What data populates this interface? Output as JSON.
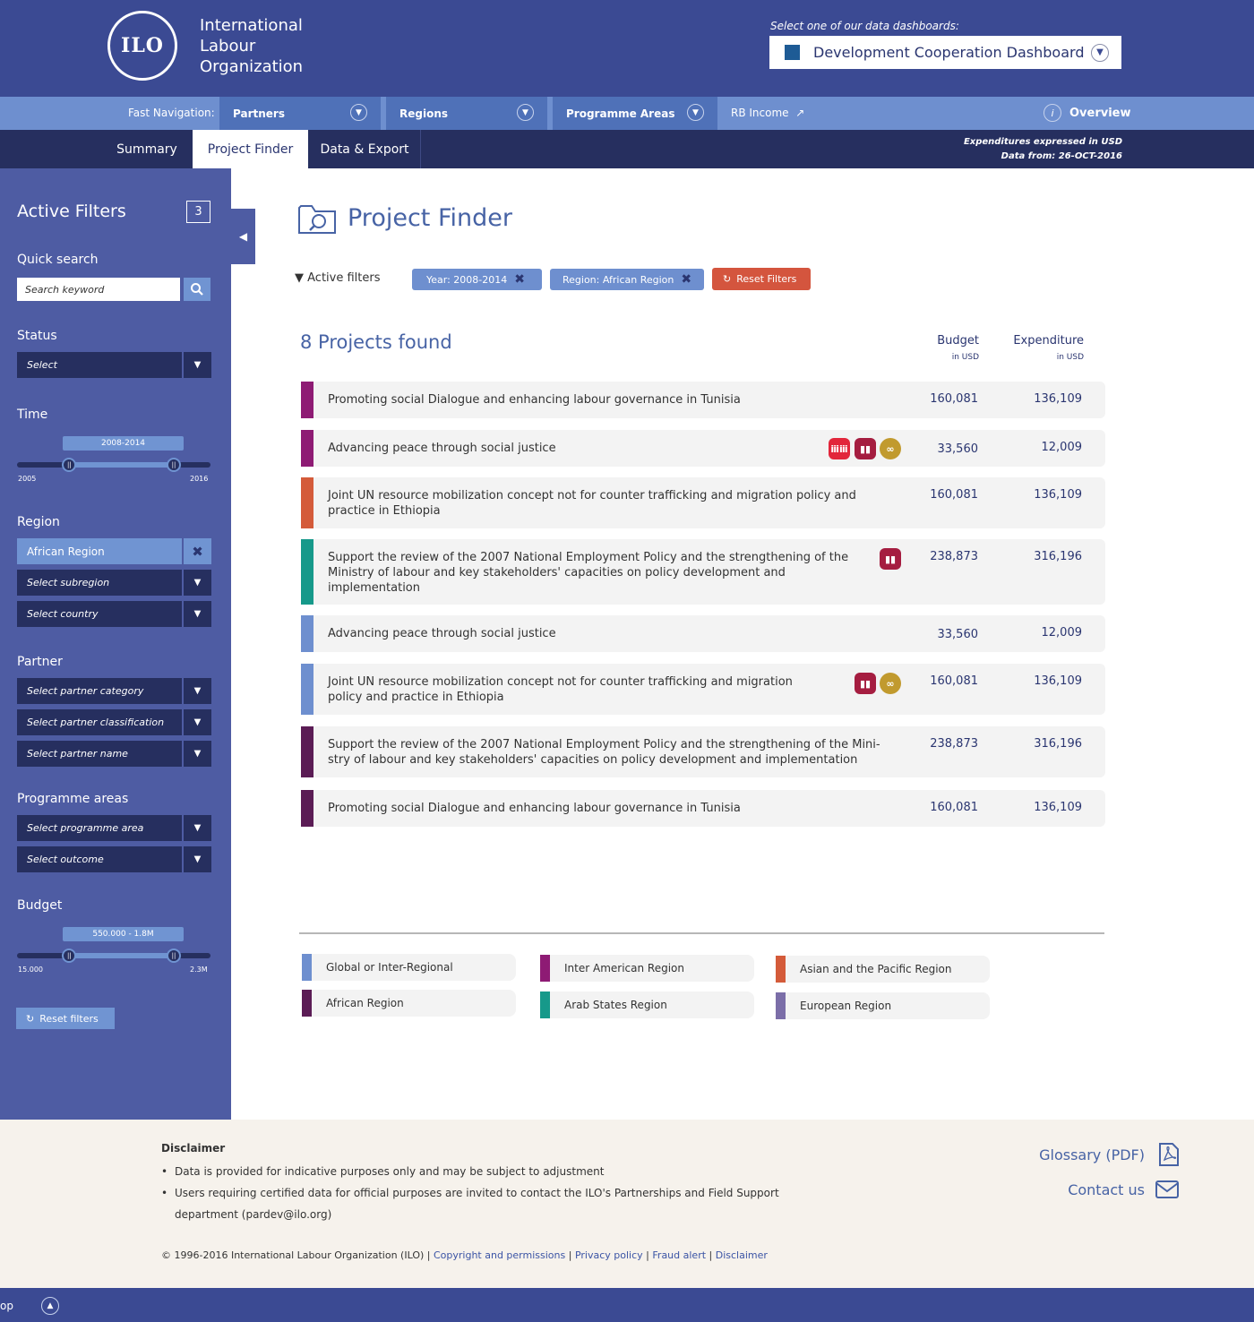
{
  "header": {
    "logo_text": "ILO",
    "org_line1": "International",
    "org_line2": "Labour",
    "org_line3": "Organization",
    "dashboard_prompt": "Select one of our data dashboards:",
    "dashboard_selected": "Development Cooperation Dashboard"
  },
  "fastnav": {
    "label": "Fast Navigation:",
    "partners": "Partners",
    "regions": "Regions",
    "programme_areas": "Programme Areas",
    "rb_income": "RB Income",
    "overview": "Overview"
  },
  "tabs": {
    "summary": "Summary",
    "project_finder": "Project Finder",
    "data_export": "Data & Export",
    "note_line1": "Expenditures expressed in USD",
    "note_line2": "Data from: 26-OCT-2016"
  },
  "sidebar": {
    "title": "Active Filters",
    "count": "3",
    "quick_search_label": "Quick search",
    "search_placeholder": "Search keyword",
    "status_label": "Status",
    "status_select": "Select",
    "time_label": "Time",
    "time_range": "2008-2014",
    "time_min": "2005",
    "time_max": "2016",
    "time_low_fraction": 0.27,
    "time_high_fraction": 0.81,
    "region_label": "Region",
    "region_selected": "African Region",
    "subregion_select": "Select subregion",
    "country_select": "Select country",
    "partner_label": "Partner",
    "partner_category": "Select partner category",
    "partner_classification": "Select partner classification",
    "partner_name": "Select partner name",
    "programme_label": "Programme areas",
    "programme_area": "Select programme area",
    "outcome": "Select outcome",
    "budget_label": "Budget",
    "budget_range": "550.000 - 1.8M",
    "budget_min": "15.000",
    "budget_max": "2.3M",
    "budget_low_fraction": 0.27,
    "budget_high_fraction": 0.81,
    "reset": "Reset filters"
  },
  "main": {
    "title": "Project Finder",
    "active_filters_label": "Active filters",
    "chip_year": "Year: 2008-2014",
    "chip_region": "Region: African Region",
    "reset_filters": "Reset Filters",
    "found": "8 Projects found",
    "budget_header": "Budget",
    "budget_unit": "in USD",
    "expenditure_header": "Expenditure",
    "expenditure_unit": "in USD"
  },
  "projects": [
    {
      "title": "Promoting social Dialogue and enhancing labour governance in Tunisia",
      "budget": "160,081",
      "expenditure": "136,109",
      "color": "#8e1b74"
    },
    {
      "title": "Advancing peace through social justice",
      "budget": "33,560",
      "expenditure": "12,009",
      "color": "#8e1b74"
    },
    {
      "title": "Joint UN resource mobilization concept not for counter trafficking and migration policy and practice in Ethiopia",
      "budget": "160,081",
      "expenditure": "136,109",
      "color": "#d45b3a"
    },
    {
      "title": "Support the review of the 2007 National Employment Policy and the strengthening of the Ministry of labour and key stakeholders' capacities on policy development and implementation",
      "budget": "238,873",
      "expenditure": "316,196",
      "color": "#16998a"
    },
    {
      "title": "Advancing peace through social justice",
      "budget": "33,560",
      "expenditure": "12,009",
      "color": "#6e8fcf"
    },
    {
      "title": "Joint UN resource mobilization concept not for counter trafficking and migration policy and practice in Ethiopia",
      "budget": "160,081",
      "expenditure": "136,109",
      "color": "#6e8fcf"
    },
    {
      "title": "Support the review of the 2007 National Employment Policy and the strengthening of the Mini- stry of labour and key stakeholders' capacities on policy development and implementation",
      "budget": "238,873",
      "expenditure": "316,196",
      "color": "#5b1c55"
    },
    {
      "title": "Promoting social Dialogue and enhancing labour governance in Tunisia",
      "budget": "160,081",
      "expenditure": "136,109",
      "color": "#5b1c55"
    }
  ],
  "badges": {
    "people": "#e2263b",
    "growth": "#a51d40",
    "infinity": "#c19a2e"
  },
  "legend": [
    {
      "label": "Global or Inter-Regional",
      "color": "#6e8fcf"
    },
    {
      "label": "Inter American Region",
      "color": "#8e1b74"
    },
    {
      "label": "Asian and the Pacific Region",
      "color": "#d45b3a"
    },
    {
      "label": "African Region",
      "color": "#5b1c55"
    },
    {
      "label": "Arab States Region",
      "color": "#16998a"
    },
    {
      "label": "European Region",
      "color": "#7b6ea8"
    }
  ],
  "footer": {
    "disclaimer_title": "Disclaimer",
    "bullet1": "Data is provided for indicative purposes only and may be subject to adjustment",
    "bullet2": "Users requiring certified data for official purposes are invited to contact the ILO's Partnerships and Field Support department (pardev@ilo.org)",
    "glossary": "Glossary (PDF)",
    "contact": "Contact us",
    "copyright": "© 1996-2016 International Labour Organization (ILO) |",
    "link_copyright": "Copyright and permissions",
    "link_privacy": "Privacy policy",
    "link_fraud": "Fraud alert",
    "link_disclaimer": "Disclaimer",
    "sep": "|",
    "bottom_text": "op"
  }
}
